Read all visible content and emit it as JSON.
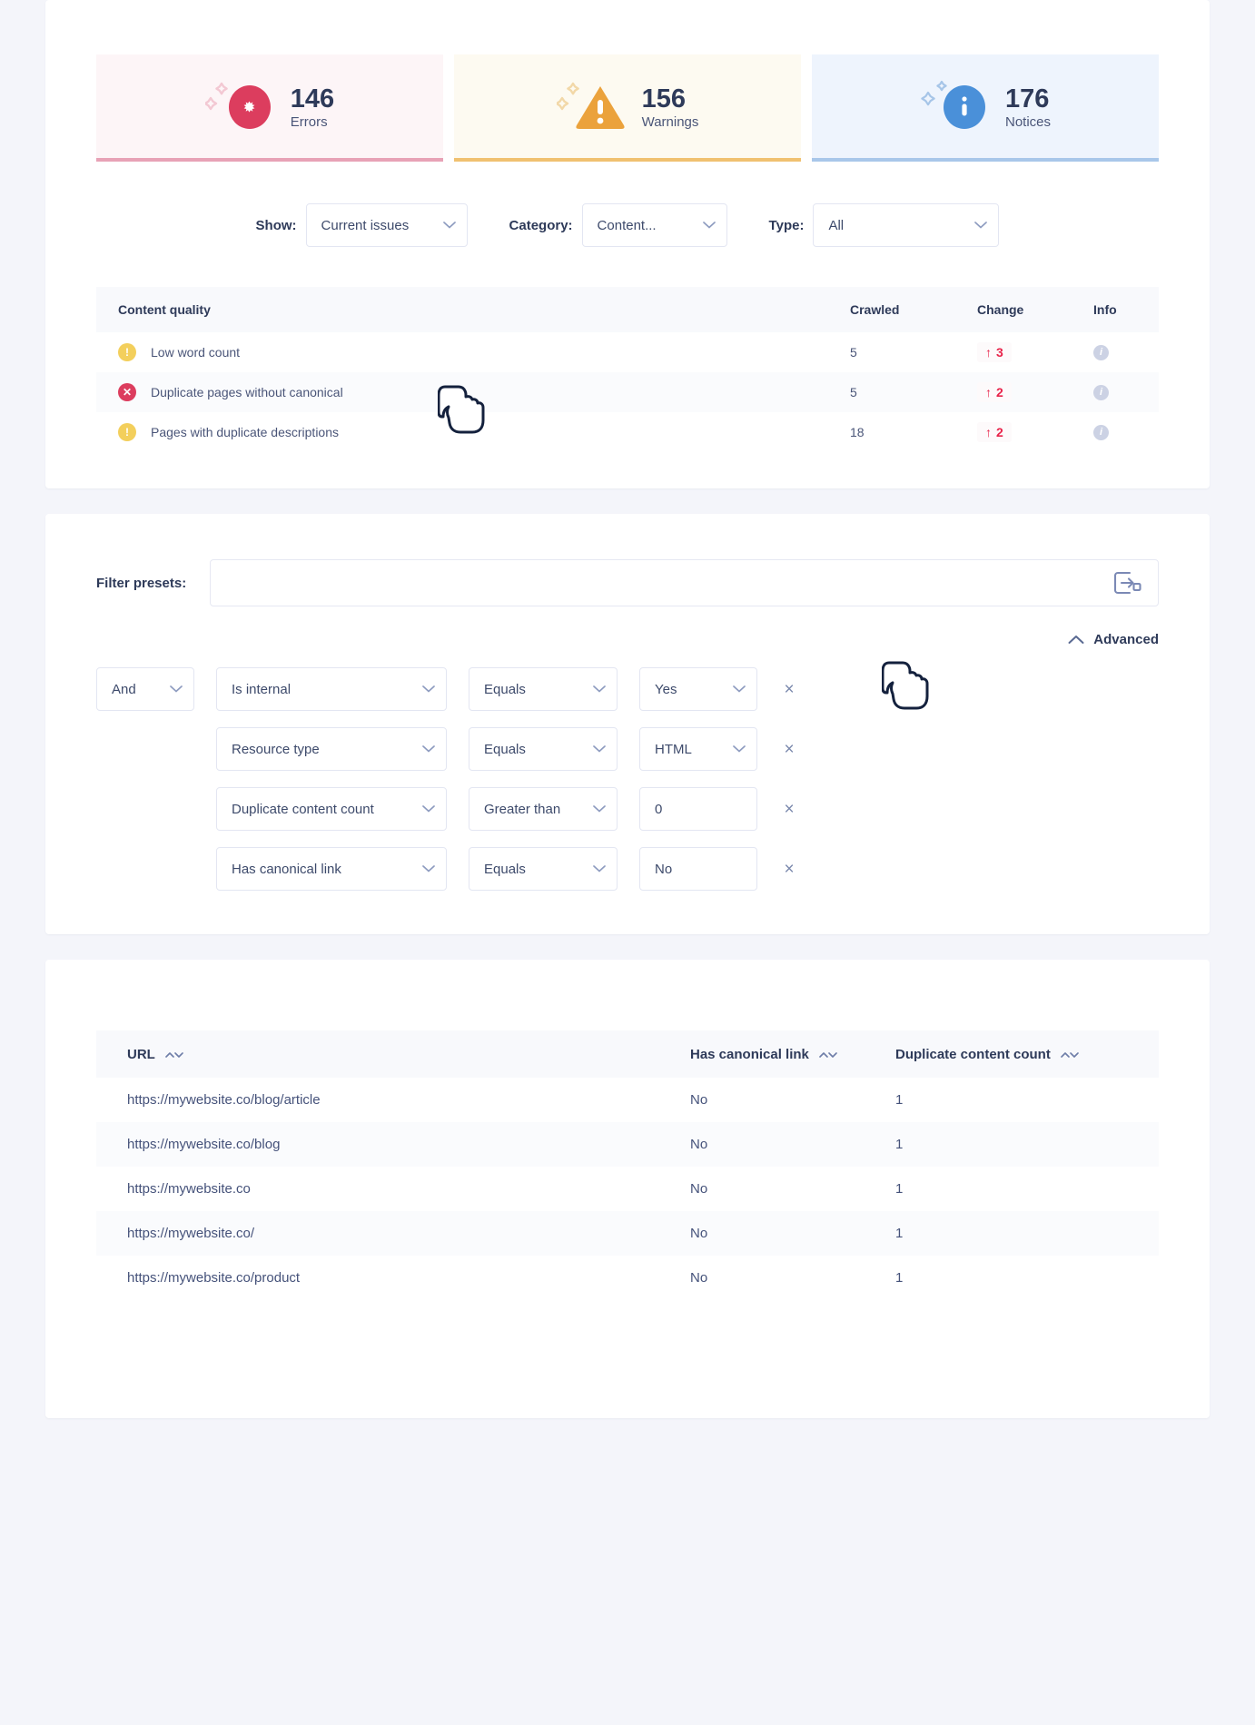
{
  "summary": {
    "cards": [
      {
        "count": "146",
        "label": "Errors",
        "kind": "error",
        "accent": "#dc3d5e",
        "bg": "#fdf5f7"
      },
      {
        "count": "156",
        "label": "Warnings",
        "kind": "warning",
        "accent": "#eba23c",
        "bg": "#fdfaf1"
      },
      {
        "count": "176",
        "label": "Notices",
        "kind": "notice",
        "accent": "#4a90d9",
        "bg": "#eef4fd"
      }
    ]
  },
  "filters_bar": {
    "show_label": "Show:",
    "show_value": "Current issues",
    "category_label": "Category:",
    "category_value": "Content...",
    "type_label": "Type:",
    "type_value": "All"
  },
  "issues_table": {
    "headers": {
      "name": "Content quality",
      "crawled": "Crawled",
      "change": "Change",
      "info": "Info"
    },
    "rows": [
      {
        "icon": "warning",
        "name": "Low word count",
        "crawled": "5",
        "change": "3",
        "change_dir": "↑",
        "info": "i"
      },
      {
        "icon": "error",
        "name": "Duplicate pages without canonical",
        "crawled": "5",
        "change": "2",
        "change_dir": "↑",
        "info": "i"
      },
      {
        "icon": "warning",
        "name": "Pages with duplicate descriptions",
        "crawled": "18",
        "change": "2",
        "change_dir": "↑",
        "info": "i"
      }
    ]
  },
  "filter_builder": {
    "presets_label": "Filter presets:",
    "presets_value": "",
    "presets_placeholder": "",
    "save_preset_icon": "save-preset-icon",
    "advanced_label": "Advanced",
    "advanced_chevron": "chevron-up-icon",
    "operator": "And",
    "conditions": [
      {
        "field": "Is internal",
        "comparator": "Equals",
        "value": "Yes",
        "value_type": "select"
      },
      {
        "field": "Resource type",
        "comparator": "Equals",
        "value": "HTML",
        "value_type": "select"
      },
      {
        "field": "Duplicate content count",
        "comparator": "Greater than",
        "value": "0",
        "value_type": "text"
      },
      {
        "field": "Has canonical link",
        "comparator": "Equals",
        "value": "No",
        "value_type": "select"
      }
    ],
    "remove_label": "×"
  },
  "results_table": {
    "headers": {
      "url": "URL",
      "canonical": "Has canonical link",
      "duplicate": "Duplicate content count"
    },
    "rows": [
      {
        "url": "https://mywebsite.co/blog/article",
        "canonical": "No",
        "duplicate": "1"
      },
      {
        "url": "https://mywebsite.co/blog",
        "canonical": "No",
        "duplicate": "1"
      },
      {
        "url": "https://mywebsite.co",
        "canonical": "No",
        "duplicate": "1"
      },
      {
        "url": "https://mywebsite.co/",
        "canonical": "No",
        "duplicate": "1"
      },
      {
        "url": "https://mywebsite.co/product",
        "canonical": "No",
        "duplicate": "1"
      }
    ]
  }
}
